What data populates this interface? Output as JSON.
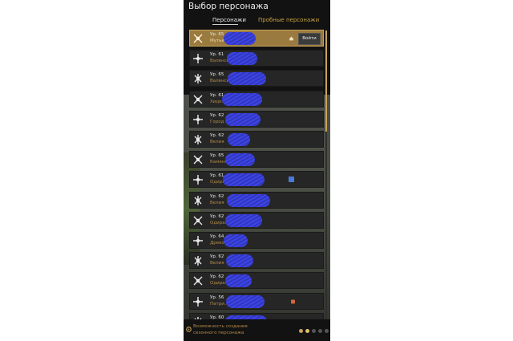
{
  "title": "Выбор персонажа",
  "tabs": [
    {
      "label": "Персонажи",
      "active": true
    },
    {
      "label": "Пробные персонажи",
      "active": false
    }
  ],
  "login_label": "Войти",
  "characters": [
    {
      "level": "Ур. 65",
      "location": "Мутьен",
      "selected": true
    },
    {
      "level": "Ур. 61",
      "location": "Валенсия"
    },
    {
      "level": "Ур. 65",
      "location": "Валенсия"
    },
    {
      "level": "Ур. 61",
      "location": "Хидел"
    },
    {
      "level": "Ур. 62",
      "location": "Город Хидел"
    },
    {
      "level": "Ур. 62",
      "location": "Велия"
    },
    {
      "level": "Ур. 65",
      "location": "Каменный ... песка"
    },
    {
      "level": "Ур. 61",
      "location": "Одиралит"
    },
    {
      "level": "Ур. 62",
      "location": "Велия"
    },
    {
      "level": "Ур. 62",
      "location": "Одиралит"
    },
    {
      "level": "Ур. 64",
      "location": "Древо"
    },
    {
      "level": "Ур. 62",
      "location": "Велия"
    },
    {
      "level": "Ур. 62",
      "location": "Одиралит"
    },
    {
      "level": "Ур. 56",
      "location": "Патри..."
    },
    {
      "level": "Ур. 60",
      "location": ""
    }
  ],
  "bottom": {
    "line1": "Возможность создания",
    "line2": "сезонного персонажа"
  },
  "colors": {
    "accent": "#c9a45a",
    "selected_row": "#9a7a3e",
    "redaction": "#3f45e0",
    "tab_trial": "#c8a040"
  }
}
